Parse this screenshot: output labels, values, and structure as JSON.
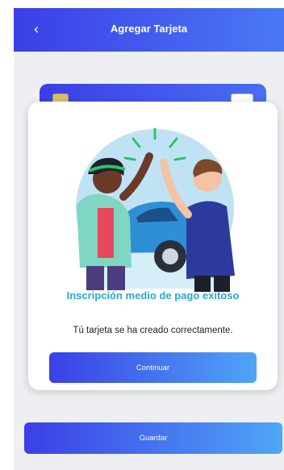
{
  "header": {
    "title": "Agregar Tarjeta",
    "back_icon": "chevron-left-icon",
    "back_glyph": "‹"
  },
  "modal": {
    "title": "Inscripción medio de pago exitoso",
    "message": "Tú tarjeta se ha creado correctamente.",
    "continue_label": "Continuar"
  },
  "footer": {
    "save_label": "Guardar"
  },
  "colors": {
    "primary": "#3b3fe6",
    "secondary": "#4fa6f7",
    "title_teal": "#2aa8c8",
    "background": "#eeeff2"
  }
}
